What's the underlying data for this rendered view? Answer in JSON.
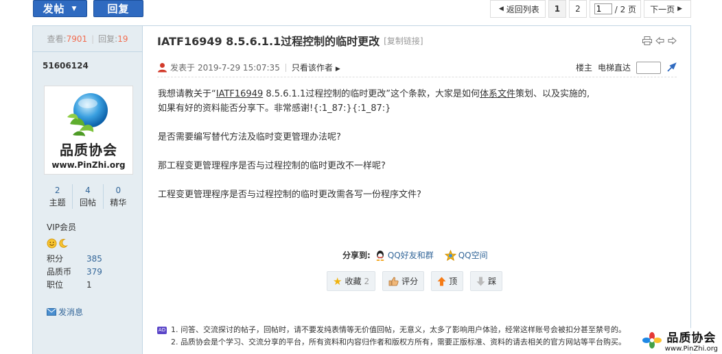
{
  "toolbar": {
    "post_label": "发帖",
    "reply_label": "回复"
  },
  "pager": {
    "back_label": "返回列表",
    "pages": [
      "1",
      "2"
    ],
    "current_value": "1",
    "total_label": "/ 2 页",
    "next_label": "下一页"
  },
  "sidebar": {
    "views_label": "查看:",
    "views": "7901",
    "replies_label": "回复:",
    "replies": "19",
    "username": "51606124",
    "avatar_title": "品质协会",
    "avatar_url": "www.PinZhi.org",
    "counts": [
      {
        "value": "2",
        "label": "主题"
      },
      {
        "value": "4",
        "label": "回帖"
      },
      {
        "value": "0",
        "label": "精华"
      }
    ],
    "level": "VIP会员",
    "stats": [
      {
        "key": "积分",
        "value": "385"
      },
      {
        "key": "品质币",
        "value": "379"
      },
      {
        "key": "职位",
        "value": "1"
      }
    ],
    "message_label": "发消息"
  },
  "post": {
    "title": "IATF16949 8.5.6.1.1过程控制的临时更改",
    "copy_link": "[复制链接]",
    "posted_label": "发表于",
    "posted_time": "2019-7-29 15:07:35",
    "only_author": "只看该作者",
    "floor": "楼主",
    "jump_label": "电梯直达",
    "p1_a": "我想请教关于“",
    "p1_link": "IATF16949",
    "p1_b": " 8.5.6.1.1过程控制的临时更改”这个条款，大家是如何",
    "p1_link2": "体系文件",
    "p1_c": "策划、以及实施的,",
    "p1_line2": "如果有好的资料能否分享下。非常感谢!{:1_87:}{:1_87:}",
    "p2": "是否需要编写替代方法及临时变更管理办法呢?",
    "p3": "那工程变更管理程序是否与过程控制的临时更改不一样呢?",
    "p4": "工程变更管理程序是否与过程控制的临时更改需各写一份程序文件?"
  },
  "share": {
    "label": "分享到:",
    "qq_friends": "QQ好友和群",
    "qq_zone": "QQ空间"
  },
  "actions": {
    "favorite": "收藏",
    "favorite_count": "2",
    "rate": "评分",
    "up": "顶",
    "down": "踩"
  },
  "notice": {
    "ad_badge": "AD",
    "line1": "1. 问答、交流探讨的帖子，回帖时，请不要发纯表情等无价值回帖，无意义，太多了影响用户体验，经常这样账号会被扣分甚至禁号的。",
    "line2": "2. 品质协会是个学习、交流分享的平台，所有资料和内容归作者和版权方所有，需要正版标准、资料的请去相关的官方网站等平台购买。"
  },
  "watermark": {
    "title": "品质协会",
    "url": "www.PinZhi.org"
  },
  "colors": {
    "button_blue": "#2f6ac0",
    "sidebar_bg": "#e5edf2",
    "border": "#c2d5e3",
    "link": "#336699",
    "number_red": "#f26c4f"
  }
}
